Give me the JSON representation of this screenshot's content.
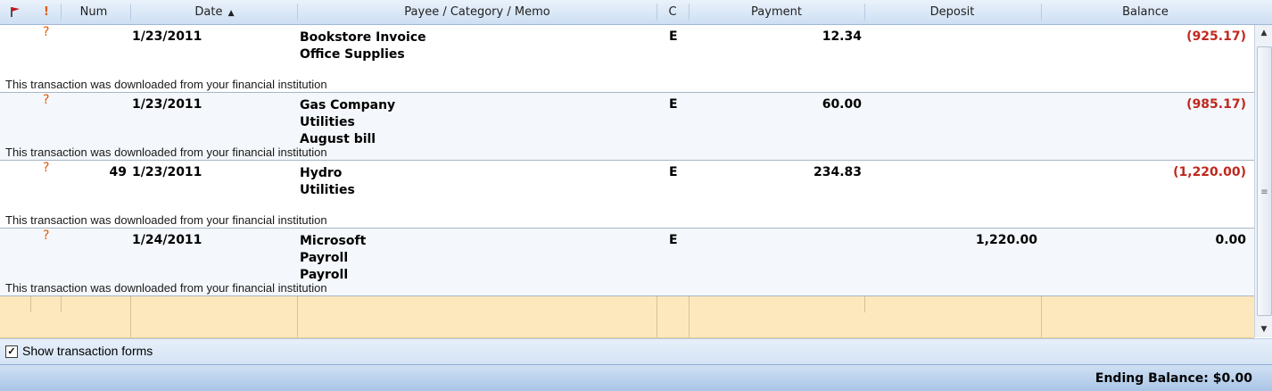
{
  "header": {
    "flag_icon": "flag-icon",
    "excl_label": "!",
    "num": "Num",
    "date": "Date",
    "sort_indicator": "▲",
    "payee": "Payee / Category / Memo",
    "c": "C",
    "payment": "Payment",
    "deposit": "Deposit",
    "balance": "Balance"
  },
  "transactions": [
    {
      "status": "?",
      "num": "",
      "date": "1/23/2011",
      "payee": "Bookstore Invoice",
      "category": "Office Supplies",
      "memo": "",
      "cleared": "E",
      "payment": "12.34",
      "deposit": "",
      "balance": "(925.17)",
      "note": "This transaction was downloaded from your financial institution"
    },
    {
      "status": "?",
      "num": "",
      "date": "1/23/2011",
      "payee": "Gas Company",
      "category": "Utilities",
      "memo": "August bill",
      "cleared": "E",
      "payment": "60.00",
      "deposit": "",
      "balance": "(985.17)",
      "note": "This transaction was downloaded from your financial institution"
    },
    {
      "status": "?",
      "num": "49",
      "date": "1/23/2011",
      "payee": "Hydro",
      "category": "Utilities",
      "memo": "",
      "cleared": "E",
      "payment": "234.83",
      "deposit": "",
      "balance": "(1,220.00)",
      "note": "This transaction was downloaded from your financial institution"
    },
    {
      "status": "?",
      "num": "",
      "date": "1/24/2011",
      "payee": "Microsoft",
      "category": "Payroll",
      "memo": "Payroll",
      "cleared": "E",
      "payment": "",
      "deposit": "1,220.00",
      "balance": "0.00",
      "note": "This transaction was downloaded from your financial institution"
    }
  ],
  "options": {
    "show_forms_label": "Show transaction forms",
    "show_forms_checked": true
  },
  "footer": {
    "ending_balance": "Ending Balance: $0.00"
  },
  "colors": {
    "negative": "#c0281e",
    "status": "#e05a00",
    "entry_row": "#fde7bd"
  }
}
